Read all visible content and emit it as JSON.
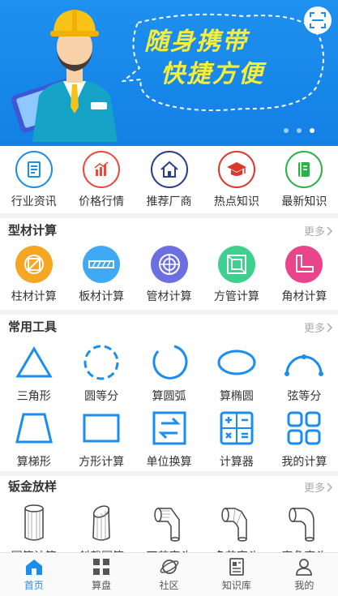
{
  "banner": {
    "title": "随身携带",
    "subtitle": "快捷方便",
    "slides": 3,
    "active_slide": 3
  },
  "quick_nav": [
    {
      "label": "行业资讯",
      "icon": "news-icon",
      "color": "#1e8fdf"
    },
    {
      "label": "价格行情",
      "icon": "chart-icon",
      "color": "#e84a3c"
    },
    {
      "label": "推荐厂商",
      "icon": "house-icon",
      "color": "#2a3f8f"
    },
    {
      "label": "热点知识",
      "icon": "graduation-cap-icon",
      "color": "#d93a2a"
    },
    {
      "label": "最新知识",
      "icon": "book-icon",
      "color": "#2bb04a"
    }
  ],
  "section_material": {
    "title": "型材计算",
    "more": "更多",
    "items": [
      {
        "label": "柱材计算",
        "icon": "column-material-icon",
        "color": "#f5a623"
      },
      {
        "label": "板材计算",
        "icon": "plate-material-icon",
        "color": "#3fa9f5"
      },
      {
        "label": "管材计算",
        "icon": "pipe-material-icon",
        "color": "#6b6fe0"
      },
      {
        "label": "方管计算",
        "icon": "square-tube-icon",
        "color": "#3fcf8e"
      },
      {
        "label": "角材计算",
        "icon": "angle-material-icon",
        "color": "#e8458b"
      }
    ]
  },
  "section_tools": {
    "title": "常用工具",
    "more": "更多",
    "row1": [
      {
        "label": "三角形",
        "icon": "triangle-icon"
      },
      {
        "label": "圆等分",
        "icon": "circle-division-icon"
      },
      {
        "label": "算圆弧",
        "icon": "arc-icon"
      },
      {
        "label": "算椭圆",
        "icon": "ellipse-icon"
      },
      {
        "label": "弦等分",
        "icon": "chord-division-icon"
      }
    ],
    "row2": [
      {
        "label": "算梯形",
        "icon": "trapezoid-icon"
      },
      {
        "label": "方形计算",
        "icon": "square-icon"
      },
      {
        "label": "单位换算",
        "icon": "unit-convert-icon"
      },
      {
        "label": "计算器",
        "icon": "calculator-icon"
      },
      {
        "label": "我的计算",
        "icon": "my-calc-grid-icon"
      }
    ],
    "color": "#1a8ef0"
  },
  "section_sheet": {
    "title": "钣金放样",
    "more": "更多",
    "items": [
      {
        "label": "圆筒计算",
        "icon": "cylinder-icon"
      },
      {
        "label": "斜截圆筒",
        "icon": "oblique-cylinder-icon"
      },
      {
        "label": "两节弯头",
        "icon": "two-section-elbow-icon"
      },
      {
        "label": "多节弯头",
        "icon": "multi-section-elbow-icon"
      },
      {
        "label": "直角弯头",
        "icon": "right-angle-elbow-icon"
      }
    ]
  },
  "tabbar": [
    {
      "label": "首页",
      "icon": "home-icon",
      "active": true
    },
    {
      "label": "算盘",
      "icon": "grid-icon",
      "active": false
    },
    {
      "label": "社区",
      "icon": "planet-icon",
      "active": false
    },
    {
      "label": "知识库",
      "icon": "document-icon",
      "active": false
    },
    {
      "label": "我的",
      "icon": "person-icon",
      "active": false
    }
  ],
  "colors": {
    "accent": "#1a8ef0",
    "banner": "#1380e6",
    "banner_text": "#f7ee3a"
  }
}
